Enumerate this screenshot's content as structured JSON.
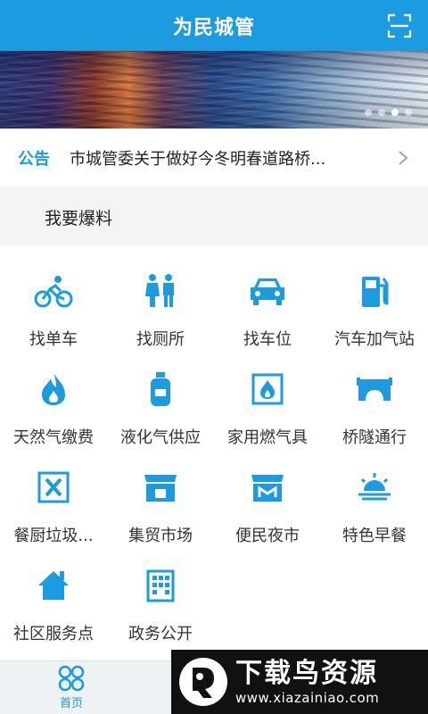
{
  "header": {
    "title": "为民城管",
    "scan_icon": "scan-icon"
  },
  "banner": {
    "slides": 4,
    "active_slide": 3
  },
  "notice": {
    "tag": "公告",
    "text": "市城管委关于做好今冬明春道路桥..."
  },
  "section": {
    "label": "我要爆料"
  },
  "accent_color": "#1d9be0",
  "services": [
    {
      "label": "找单车",
      "icon": "bicycle-icon"
    },
    {
      "label": "找厕所",
      "icon": "toilet-icon"
    },
    {
      "label": "找车位",
      "icon": "car-icon"
    },
    {
      "label": "汽车加气站",
      "icon": "gas-station-icon"
    },
    {
      "label": "天然气缴费",
      "icon": "flame-icon"
    },
    {
      "label": "液化气供应",
      "icon": "gas-cylinder-icon"
    },
    {
      "label": "家用燃气具",
      "icon": "gas-stove-icon"
    },
    {
      "label": "桥隧通行",
      "icon": "bridge-icon"
    },
    {
      "label": "餐厨垃圾...",
      "icon": "kitchen-waste-icon"
    },
    {
      "label": "集贸市场",
      "icon": "market-stall-icon"
    },
    {
      "label": "便民夜市",
      "icon": "night-market-icon"
    },
    {
      "label": "特色早餐",
      "icon": "sunrise-icon"
    },
    {
      "label": "社区服务点",
      "icon": "house-icon"
    },
    {
      "label": "政务公开",
      "icon": "government-building-icon"
    }
  ],
  "bottom_nav": {
    "home_label": "首页",
    "home_icon": "home-grid-icon"
  },
  "watermark": {
    "title": "下载鸟资源",
    "url": "www.xiazainiao.com"
  }
}
